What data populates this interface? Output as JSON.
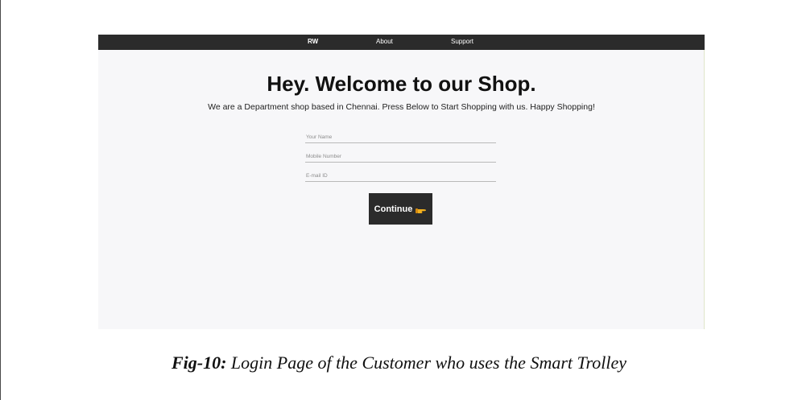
{
  "navbar": {
    "brand": "RW",
    "items": [
      "About",
      "Support"
    ]
  },
  "hero": {
    "title": "Hey. Welcome to our Shop.",
    "subtitle": "We are a Department shop based in Chennai. Press Below to Start Shopping with us. Happy Shopping!"
  },
  "form": {
    "name_placeholder": "Your Name",
    "mobile_placeholder": "Mobile Number",
    "email_placeholder": "E-mail ID",
    "continue_label": "Continue",
    "continue_icon": "pointing-hand-icon"
  },
  "caption": {
    "label": "Fig-10:",
    "text": " Login Page of the Customer who uses the Smart Trolley"
  },
  "colors": {
    "navbar": "#2b2b2b",
    "background": "#f7f7f9",
    "button": "#2b2b2b",
    "hand_icon": "#f2b01e"
  }
}
